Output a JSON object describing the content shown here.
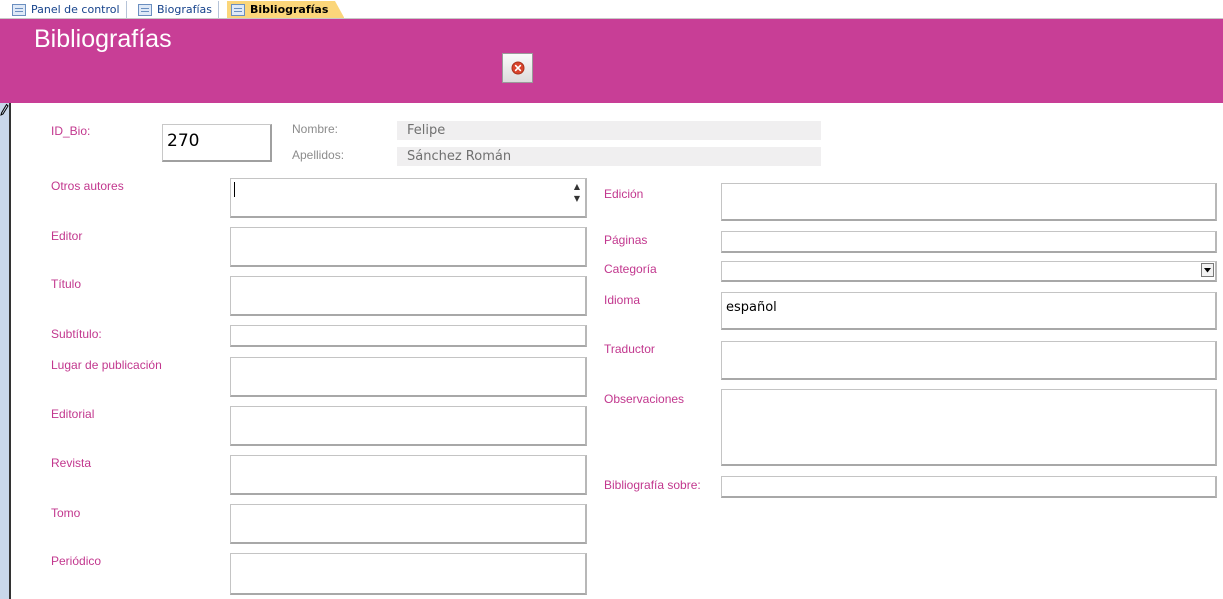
{
  "tabs": [
    {
      "label": "Panel de control"
    },
    {
      "label": "Biografías"
    },
    {
      "label": "Bibliografías"
    }
  ],
  "form": {
    "title": "Bibliografías"
  },
  "colors": {
    "header": "#c83e96",
    "label": "#c2378e",
    "active_tab": "#fbd67a"
  },
  "fields": {
    "id_bio": {
      "label": "ID_Bio:",
      "value": "270"
    },
    "nombre": {
      "label": "Nombre:",
      "value": "Felipe"
    },
    "apellidos": {
      "label": "Apellidos:",
      "value": "Sánchez Román"
    },
    "otros_autores": {
      "label": "Otros autores",
      "value": ""
    },
    "editor": {
      "label": "Editor",
      "value": ""
    },
    "titulo": {
      "label": "Título",
      "value": ""
    },
    "subtitulo": {
      "label": "Subtítulo:",
      "value": ""
    },
    "lugar": {
      "label": "Lugar de publicación",
      "value": ""
    },
    "editorial": {
      "label": "Editorial",
      "value": ""
    },
    "revista": {
      "label": "Revista",
      "value": ""
    },
    "tomo": {
      "label": "Tomo",
      "value": ""
    },
    "periodico": {
      "label": "Periódico",
      "value": ""
    },
    "edicion": {
      "label": "Edición",
      "value": ""
    },
    "paginas": {
      "label": "Páginas",
      "value": ""
    },
    "categoria": {
      "label": "Categoría",
      "value": ""
    },
    "idioma": {
      "label": "Idioma",
      "value": "español"
    },
    "traductor": {
      "label": "Traductor",
      "value": ""
    },
    "observaciones": {
      "label": "Observaciones",
      "value": ""
    },
    "bibliografia_sobre": {
      "label": "Bibliografía sobre:",
      "value": ""
    }
  },
  "icons": {
    "close": "close-icon",
    "record": "pencil-icon",
    "tab": "form-icon"
  }
}
